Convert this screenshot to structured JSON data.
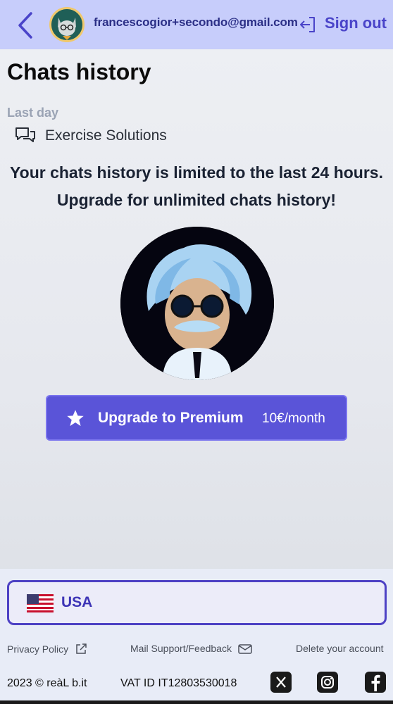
{
  "header": {
    "email": "francescogior+secondo@gmail.com",
    "sign_out_label": "Sign out"
  },
  "page": {
    "title": "Chats history",
    "section_label": "Last day",
    "chats": [
      {
        "title": "Exercise Solutions",
        "icon": "chat-bubbles-icon"
      }
    ],
    "limit_message": "Your chats history is limited to the last 24 hours. Upgrade for unlimited chats history!"
  },
  "upgrade": {
    "label": "Upgrade to Premium",
    "price": "10€/month",
    "icon": "star-icon",
    "color": "#5a54d8"
  },
  "footer": {
    "country": "USA",
    "country_flag": "us-flag-icon",
    "privacy_policy": "Privacy Policy",
    "mail_support": "Mail Support/Feedback",
    "delete_account": "Delete your account",
    "copyright": "2023 © reàL b.it",
    "vat": "VAT ID IT12803530018",
    "social": [
      "x-icon",
      "instagram-icon",
      "facebook-icon"
    ]
  },
  "colors": {
    "header_bg": "#c7cdfb",
    "accent": "#4a44c9",
    "country_border": "#4d41c4"
  }
}
